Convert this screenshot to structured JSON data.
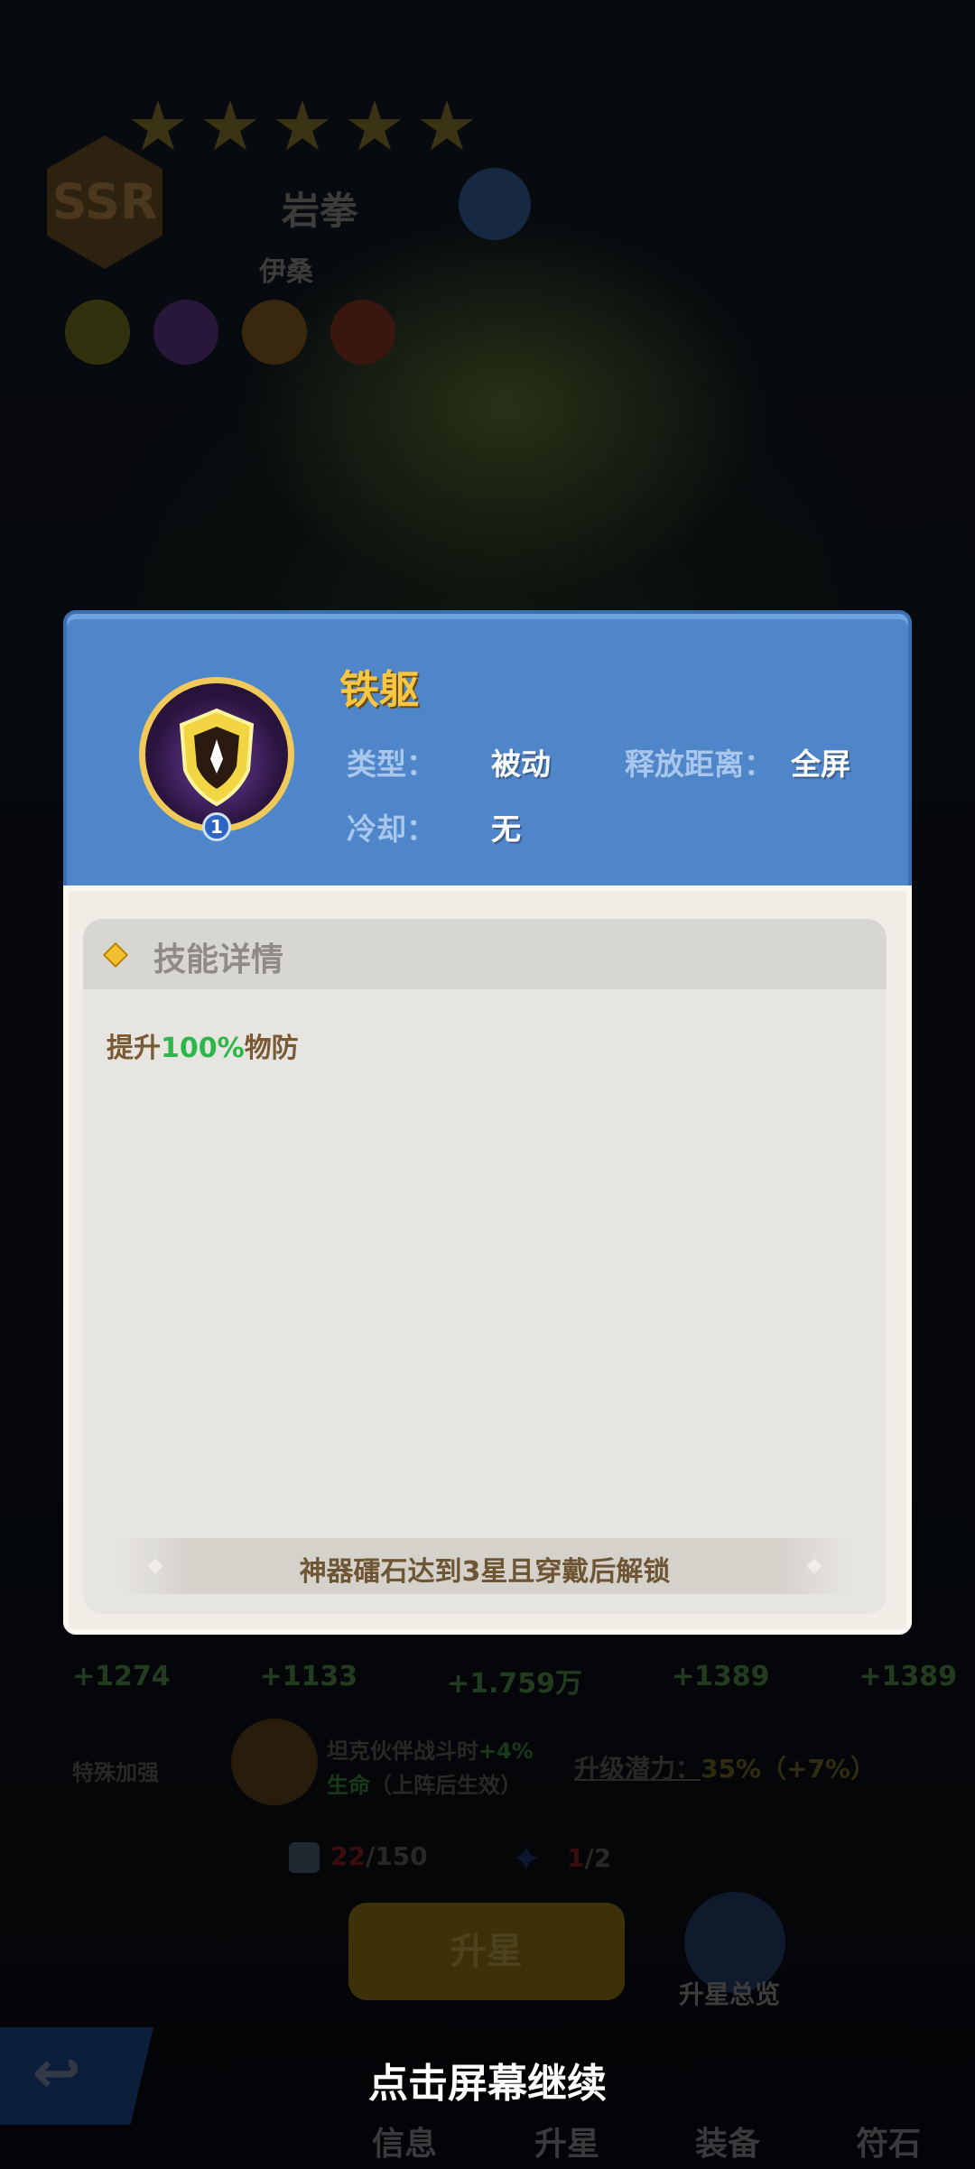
{
  "hero": {
    "rarity": "SSR",
    "name": "岩拳",
    "subtitle": "伊桑",
    "stars": 5
  },
  "popup": {
    "skill_name": "铁躯",
    "skill_level": "1",
    "type_label": "类型：",
    "type_value": "被动",
    "range_label": "释放距离：",
    "range_value": "全屏",
    "cooldown_label": "冷却：",
    "cooldown_value": "无",
    "detail_title": "技能详情",
    "desc_prefix": "提升",
    "desc_highlight": "100%",
    "desc_suffix": "物防",
    "unlock_text": "神器礌石达到3星且穿戴后解锁"
  },
  "stats": [
    "+1274",
    "+1133",
    "+1.759万",
    "+1389",
    "+1389"
  ],
  "special": {
    "label": "特殊加强",
    "line1": "坦克伙伴战斗时",
    "line1_bonus": "+4%",
    "line2_attr": "生命",
    "line2_rest": "（上阵后生效）",
    "potential_label": "升级潜力：",
    "potential_value": "35%（+7%）"
  },
  "counters": {
    "shards_current": "22",
    "shards_total": "/150",
    "stars_current": "1",
    "stars_total": "/2"
  },
  "buttons": {
    "upgrade_star": "升星",
    "overview": "升星总览"
  },
  "nav": [
    "信息",
    "升星",
    "装备",
    "符石"
  ],
  "continue_text": "点击屏幕继续",
  "colors": {
    "header_blue": "#4f86c9",
    "skill_name_gold": "#f8c640",
    "highlight_green": "#2fb64a"
  }
}
